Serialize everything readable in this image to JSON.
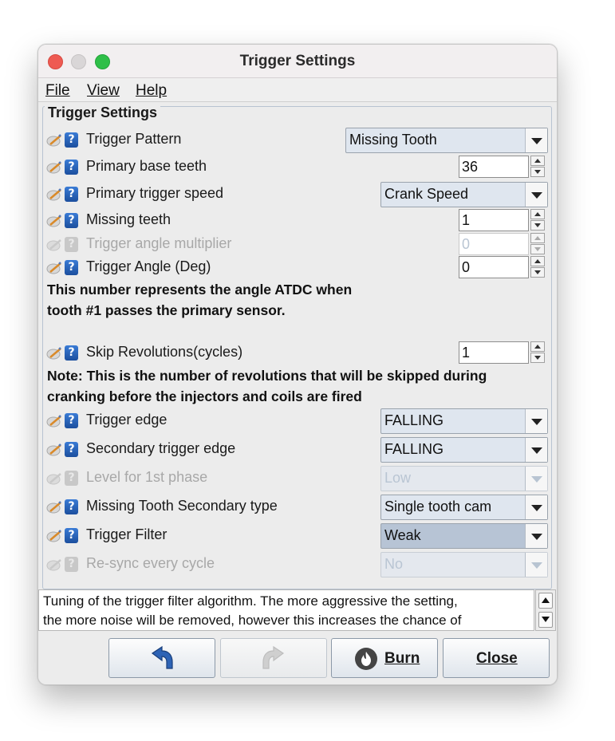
{
  "window": {
    "title": "Trigger Settings"
  },
  "menu": {
    "file": "File",
    "view": "View",
    "help": "Help"
  },
  "panel": {
    "legend": "Trigger Settings"
  },
  "fields": [
    {
      "label": "Trigger Pattern",
      "value": "Missing Tooth",
      "type": "combo"
    },
    {
      "label": "Primary base teeth",
      "value": "36",
      "type": "spinner"
    },
    {
      "label": "Primary trigger speed",
      "value": "Crank Speed",
      "type": "combo"
    },
    {
      "label": "Missing teeth",
      "value": "1",
      "type": "spinner"
    },
    {
      "label": "Trigger angle multiplier",
      "value": "0",
      "type": "spinner",
      "enabled": false
    },
    {
      "label": "Trigger Angle (Deg)",
      "value": "0",
      "type": "spinner"
    },
    {
      "label": "Skip Revolutions(cycles)",
      "value": "1",
      "type": "spinner"
    },
    {
      "label": "Trigger edge",
      "value": "FALLING",
      "type": "combo"
    },
    {
      "label": "Secondary trigger edge",
      "value": "FALLING",
      "type": "combo"
    },
    {
      "label": "Level for 1st phase",
      "value": "Low",
      "type": "combo",
      "enabled": false
    },
    {
      "label": "Missing Tooth Secondary type",
      "value": "Single tooth cam",
      "type": "combo"
    },
    {
      "label": "Trigger Filter",
      "value": "Weak",
      "type": "combo",
      "focused": true
    },
    {
      "label": "Re-sync every cycle",
      "value": "No",
      "type": "combo",
      "enabled": false
    }
  ],
  "notes": {
    "angle_line1": "This number represents the angle ATDC when",
    "angle_line2": "tooth #1 passes the primary sensor.",
    "skip_line1": "Note: This is the number of revolutions that will be skipped during",
    "skip_line2": "cranking before the injectors and coils are fired"
  },
  "description": {
    "line1": "Tuning of the trigger filter algorithm. The more aggressive the setting,",
    "line2": "the more noise will be removed, however this increases the chance of"
  },
  "buttons": {
    "undo_icon": "undo-icon",
    "redo_icon": "redo-icon",
    "burn": "Burn",
    "close": "Close"
  },
  "colors": {
    "help_icon": "#1c4f9e",
    "combo_bg": "#dfe6ef",
    "selected_combo_bg": "#b7c4d5"
  }
}
